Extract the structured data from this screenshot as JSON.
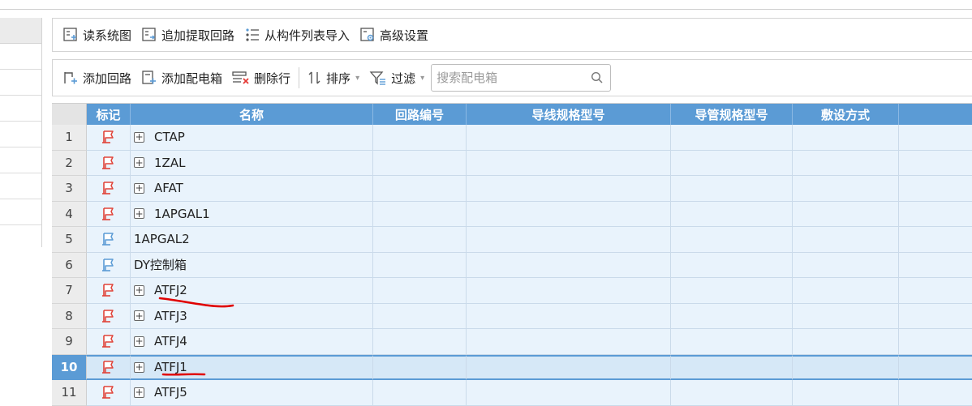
{
  "toolbar1": {
    "read_system_diagram": "读系统图",
    "add_extract_circuit": "追加提取回路",
    "import_from_component_list": "从构件列表导入",
    "advanced_settings": "高级设置"
  },
  "toolbar2": {
    "add_circuit": "添加回路",
    "add_distribution_box": "添加配电箱",
    "delete_row": "删除行",
    "sort": "排序",
    "filter": "过滤",
    "search_placeholder": "搜索配电箱"
  },
  "table": {
    "columns": [
      "标记",
      "名称",
      "回路编号",
      "导线规格型号",
      "导管规格型号",
      "敷设方式",
      ""
    ],
    "rows": [
      {
        "num": "1",
        "name": "CTAP",
        "expandable": true,
        "flag": "red"
      },
      {
        "num": "2",
        "name": "1ZAL",
        "expandable": true,
        "flag": "red"
      },
      {
        "num": "3",
        "name": "AFAT",
        "expandable": true,
        "flag": "red"
      },
      {
        "num": "4",
        "name": "1APGAL1",
        "expandable": true,
        "flag": "red"
      },
      {
        "num": "5",
        "name": "1APGAL2",
        "expandable": false,
        "flag": "blue"
      },
      {
        "num": "6",
        "name": "DY控制箱",
        "expandable": false,
        "flag": "blue"
      },
      {
        "num": "7",
        "name": "ATFJ2",
        "expandable": true,
        "flag": "red"
      },
      {
        "num": "8",
        "name": "ATFJ3",
        "expandable": true,
        "flag": "red"
      },
      {
        "num": "9",
        "name": "ATFJ4",
        "expandable": true,
        "flag": "red"
      },
      {
        "num": "10",
        "name": "ATFJ1",
        "expandable": true,
        "flag": "red",
        "selected": true
      },
      {
        "num": "11",
        "name": "ATFJ5",
        "expandable": true,
        "flag": "red"
      }
    ]
  },
  "colors": {
    "header_blue": "#5b9bd5",
    "row_bg": "#e9f3fc",
    "annotation_red": "#e00000",
    "flag_red": "#e0443a",
    "flag_blue": "#5b9bd5"
  }
}
